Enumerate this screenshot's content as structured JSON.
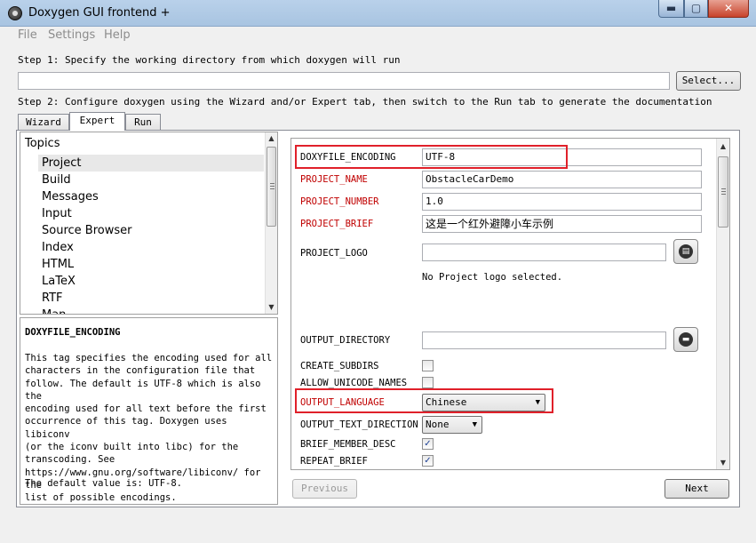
{
  "window": {
    "title": "Doxygen GUI frontend +",
    "min": "▬",
    "max": "▢",
    "close": "✕"
  },
  "menu": [
    "File",
    "Settings",
    "Help"
  ],
  "step1": {
    "label": "Step 1: Specify the working directory from which doxygen will run",
    "dir_value": "",
    "select_label": "Select..."
  },
  "step2": {
    "label": "Step 2: Configure doxygen using the Wizard and/or Expert tab, then switch to the Run tab to generate the documentation"
  },
  "tabs": [
    {
      "label": "Wizard"
    },
    {
      "label": "Expert",
      "active": true
    },
    {
      "label": "Run"
    }
  ],
  "topics": {
    "header": "Topics",
    "items": [
      "Project",
      "Build",
      "Messages",
      "Input",
      "Source Browser",
      "Index",
      "HTML",
      "LaTeX",
      "RTF",
      "Man"
    ],
    "selected": "Project"
  },
  "help": {
    "title": "DOXYFILE_ENCODING",
    "body": "This tag specifies the encoding used for all\ncharacters in the configuration file that\nfollow. The default is UTF-8 which is also the\nencoding used for all text before the first\noccurrence of this tag. Doxygen uses libiconv\n(or the iconv built into libc) for the\ntranscoding. See\nhttps://www.gnu.org/software/libiconv/ for the\nlist of possible encodings.",
    "default_line": "The default value is: UTF-8."
  },
  "options": {
    "doxyfile_encoding": {
      "label": "DOXYFILE_ENCODING",
      "value": "UTF-8"
    },
    "project_name": {
      "label": "PROJECT_NAME",
      "value": "ObstacleCarDemo"
    },
    "project_number": {
      "label": "PROJECT_NUMBER",
      "value": "1.0"
    },
    "project_brief": {
      "label": "PROJECT_BRIEF",
      "value": "这是一个红外避障小车示例"
    },
    "project_logo": {
      "label": "PROJECT_LOGO",
      "value": "",
      "note": "No Project logo selected."
    },
    "output_directory": {
      "label": "OUTPUT_DIRECTORY",
      "value": ""
    },
    "create_subdirs": {
      "label": "CREATE_SUBDIRS",
      "checked": false
    },
    "allow_unicode_names": {
      "label": "ALLOW_UNICODE_NAMES",
      "checked": false
    },
    "output_language": {
      "label": "OUTPUT_LANGUAGE",
      "value": "Chinese"
    },
    "output_text_direction": {
      "label": "OUTPUT_TEXT_DIRECTION",
      "value": "None"
    },
    "brief_member_desc": {
      "label": "BRIEF_MEMBER_DESC",
      "checked": true
    },
    "repeat_brief": {
      "label": "REPEAT_BRIEF",
      "checked": true
    }
  },
  "nav": {
    "previous": "Previous",
    "next": "Next"
  },
  "colors": {
    "required_label": "#c00000",
    "highlight": "#e0202a"
  },
  "icons": {
    "file_browse": "file-icon",
    "folder_browse": "folder-icon",
    "check": "✓",
    "combo_arrow": "▼"
  }
}
